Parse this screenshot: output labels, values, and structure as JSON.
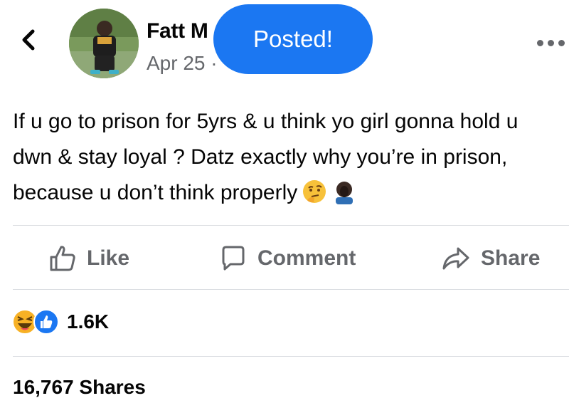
{
  "post": {
    "author": "Fatt M",
    "date": "Apr 25 ·",
    "text": "If u go to prison for 5yrs & u think yo girl gonna hold u dwn & stay loyal ? Datz exactly why you’re in prison, because u don’t think properly",
    "emojis": [
      "thinking-face-emoji",
      "facepalm-emoji"
    ]
  },
  "toast": {
    "label": "Posted!"
  },
  "actions": {
    "like": "Like",
    "comment": "Comment",
    "share": "Share"
  },
  "reactions": {
    "count": "1.6K",
    "types": [
      "haha",
      "like"
    ]
  },
  "shares": {
    "label": "16,767 Shares"
  },
  "colors": {
    "accent": "#1b77f2",
    "muted": "#65676b",
    "divider": "#dadde1",
    "haha": "#f7b125"
  }
}
